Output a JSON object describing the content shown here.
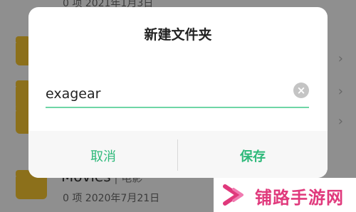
{
  "background_list": {
    "rows": [
      {
        "meta": "0 项  2021年1月3日"
      },
      {
        "meta": ""
      },
      {
        "meta": ""
      },
      {
        "name": "Movies",
        "name_suffix": "电影",
        "meta": "0 项   2020年7月21日"
      }
    ],
    "icons": {
      "folder": "folder-icon",
      "chevron": "chevron-right-icon"
    }
  },
  "dialog": {
    "title": "新建文件夹",
    "input_value": "exagear",
    "clear_icon": "clear-circle-icon",
    "cancel_label": "取消",
    "save_label": "保存",
    "accent_color": "#2eb97a"
  },
  "watermark": {
    "text": "铺路手游网",
    "logo_icon": "chevron-logo-icon",
    "color": "#e0397c"
  }
}
